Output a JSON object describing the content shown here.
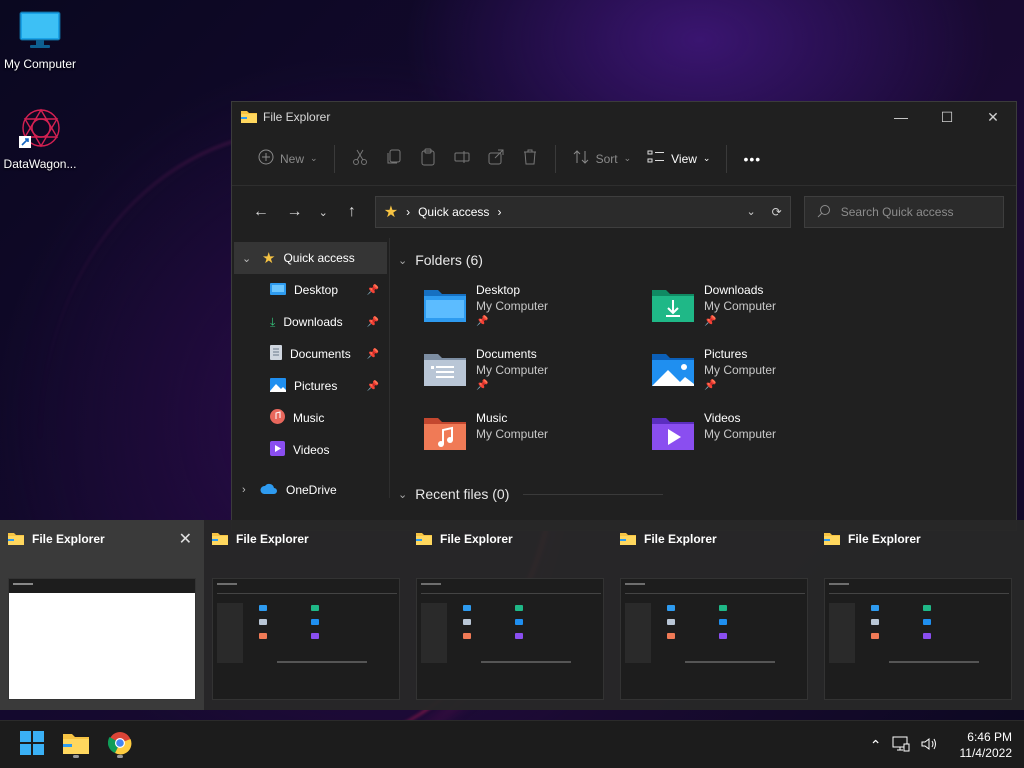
{
  "desktop": {
    "icons": [
      {
        "label": "My Computer",
        "icon": "monitor-icon"
      },
      {
        "label": "DataWagon...",
        "icon": "datawagon-shortcut-icon"
      }
    ]
  },
  "window": {
    "title": "File Explorer",
    "toolbar": {
      "new_label": "New",
      "sort_label": "Sort",
      "view_label": "View",
      "more_label": "•••"
    },
    "address": {
      "location": "Quick access"
    },
    "search": {
      "placeholder": "Search Quick access"
    },
    "nav": {
      "quick_access": "Quick access",
      "items": [
        {
          "label": "Desktop",
          "pinned": true
        },
        {
          "label": "Downloads",
          "pinned": true
        },
        {
          "label": "Documents",
          "pinned": true
        },
        {
          "label": "Pictures",
          "pinned": true
        },
        {
          "label": "Music",
          "pinned": false
        },
        {
          "label": "Videos",
          "pinned": false
        }
      ],
      "onedrive": "OneDrive"
    },
    "folders_heading": "Folders (6)",
    "folders": [
      {
        "name": "Desktop",
        "location": "My Computer",
        "pinned": true
      },
      {
        "name": "Downloads",
        "location": "My Computer",
        "pinned": true
      },
      {
        "name": "Documents",
        "location": "My Computer",
        "pinned": true
      },
      {
        "name": "Pictures",
        "location": "My Computer",
        "pinned": true
      },
      {
        "name": "Music",
        "location": "My Computer",
        "pinned": false
      },
      {
        "name": "Videos",
        "location": "My Computer",
        "pinned": false
      }
    ],
    "recent_heading": "Recent files (0)"
  },
  "switcher": {
    "cards": [
      {
        "title": "File Explorer"
      },
      {
        "title": "File Explorer"
      },
      {
        "title": "File Explorer"
      },
      {
        "title": "File Explorer"
      },
      {
        "title": "File Explorer"
      }
    ],
    "close_glyph": "✕"
  },
  "taskbar": {
    "apps": [
      "start-icon",
      "file-explorer-icon",
      "chrome-icon"
    ],
    "time": "6:46 PM",
    "date": "11/4/2022"
  },
  "colors": {
    "window_bg": "#202020",
    "accent_blue": "#2e9bf0",
    "folder_yellow": "#f6c343"
  }
}
